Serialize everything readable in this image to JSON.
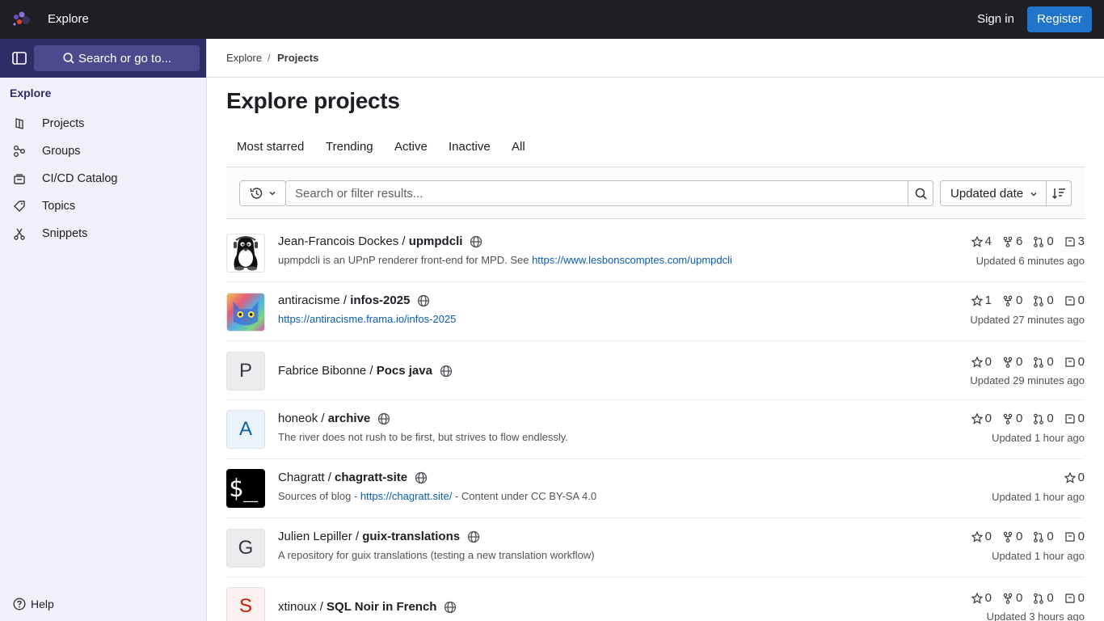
{
  "topbar": {
    "title": "Explore",
    "signin": "Sign in",
    "register": "Register"
  },
  "sidebar": {
    "search_label": "Search or go to...",
    "section": "Explore",
    "items": [
      {
        "label": "Projects",
        "icon": "project-icon"
      },
      {
        "label": "Groups",
        "icon": "group-icon"
      },
      {
        "label": "CI/CD Catalog",
        "icon": "catalog-icon"
      },
      {
        "label": "Topics",
        "icon": "label-icon"
      },
      {
        "label": "Snippets",
        "icon": "snippet-icon"
      }
    ],
    "help": "Help"
  },
  "breadcrumb": {
    "root": "Explore",
    "separator": "/",
    "current": "Projects"
  },
  "page": {
    "title": "Explore projects"
  },
  "tabs": [
    "Most starred",
    "Trending",
    "Active",
    "Inactive",
    "All"
  ],
  "filter": {
    "placeholder": "Search or filter results...",
    "sort_label": "Updated date"
  },
  "projects": [
    {
      "namespace": "Jean-Francois Dockes / ",
      "name": "upmpdcli",
      "desc_prefix": "upmpdcli is an UPnP renderer front-end for MPD. See ",
      "desc_link": "https://www.lesbonscomptes.com/upmpdcli",
      "desc_suffix": "",
      "stars": "4",
      "forks": "6",
      "mrs": "0",
      "issues": "3",
      "updated": "Updated 6 minutes ago",
      "avatar": "penguin"
    },
    {
      "namespace": "antiracisme / ",
      "name": "infos-2025",
      "desc_prefix": "",
      "desc_link": "https://antiracisme.frama.io/infos-2025",
      "desc_suffix": "",
      "stars": "1",
      "forks": "0",
      "mrs": "0",
      "issues": "0",
      "updated": "Updated 27 minutes ago",
      "avatar": "colorful-cat"
    },
    {
      "namespace": "Fabrice Bibonne / ",
      "name": "Pocs java",
      "desc_prefix": "",
      "desc_link": "",
      "desc_suffix": "",
      "stars": "0",
      "forks": "0",
      "mrs": "0",
      "issues": "0",
      "updated": "Updated 29 minutes ago",
      "avatar_letter": "P"
    },
    {
      "namespace": "honeok / ",
      "name": "archive",
      "desc_prefix": "The river does not rush to be first, but strives to flow endlessly.",
      "desc_link": "",
      "desc_suffix": "",
      "stars": "0",
      "forks": "0",
      "mrs": "0",
      "issues": "0",
      "updated": "Updated 1 hour ago",
      "avatar_letter": "A"
    },
    {
      "namespace": "Chagratt / ",
      "name": "chagratt-site",
      "desc_prefix": "Sources of blog - ",
      "desc_link": "https://chagratt.site/",
      "desc_suffix": " - Content under CC BY-SA 4.0",
      "stars": "0",
      "updated": "Updated 1 hour ago",
      "avatar": "terminal",
      "avatar_text": "$_"
    },
    {
      "namespace": "Julien Lepiller / ",
      "name": "guix-translations",
      "desc_prefix": "A repository for guix translations (testing a new translation workflow)",
      "desc_link": "",
      "desc_suffix": "",
      "stars": "0",
      "forks": "0",
      "mrs": "0",
      "issues": "0",
      "updated": "Updated 1 hour ago",
      "avatar_letter": "G"
    },
    {
      "namespace": "xtinoux / ",
      "name": "SQL Noir in French",
      "desc_prefix": "",
      "desc_link": "",
      "desc_suffix": "",
      "stars": "0",
      "forks": "0",
      "mrs": "0",
      "issues": "0",
      "updated": "Updated 3 hours ago",
      "avatar_letter": "S"
    }
  ],
  "colors": {
    "topbar": "#1f1e24",
    "sidebar_head": "#2e2e66",
    "sidebar_bg": "#f0f0f8",
    "register": "#1f75cb",
    "link": "#0b5cad"
  }
}
